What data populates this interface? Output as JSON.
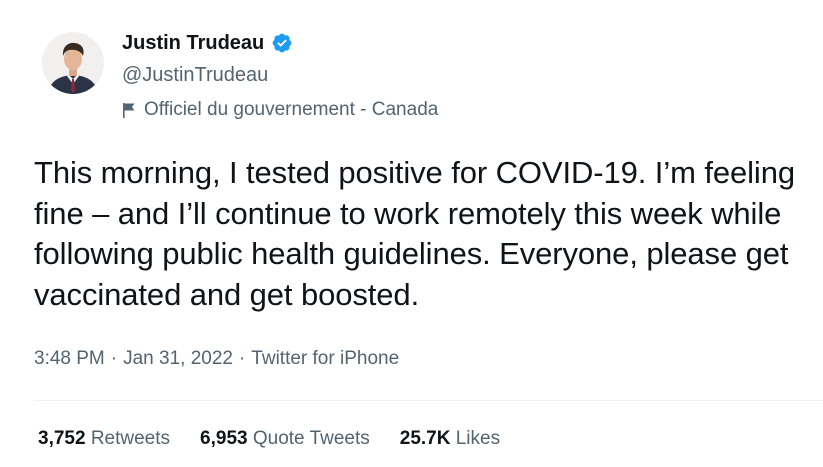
{
  "author": {
    "display_name": "Justin Trudeau",
    "handle": "@JustinTrudeau",
    "verified_icon": "verified-badge-icon",
    "verified_color": "#1d9bf0",
    "label_icon": "flag-icon",
    "label_text": "Officiel du gouvernement - Canada"
  },
  "tweet": {
    "text": "This morning, I tested positive for COVID-19. I’m feeling fine – and I’ll continue to work remotely this week while following public health guidelines. Everyone, please get vaccinated and get boosted.",
    "time": "3:48 PM",
    "separator": "·",
    "date": "Jan 31, 2022",
    "source": "Twitter for iPhone"
  },
  "stats": {
    "retweets_count": "3,752",
    "retweets_label": "Retweets",
    "quotes_count": "6,953",
    "quotes_label": "Quote Tweets",
    "likes_count": "25.7K",
    "likes_label": "Likes"
  },
  "colors": {
    "text_primary": "#0f1419",
    "text_secondary": "#536471",
    "divider": "#eff3f4"
  }
}
